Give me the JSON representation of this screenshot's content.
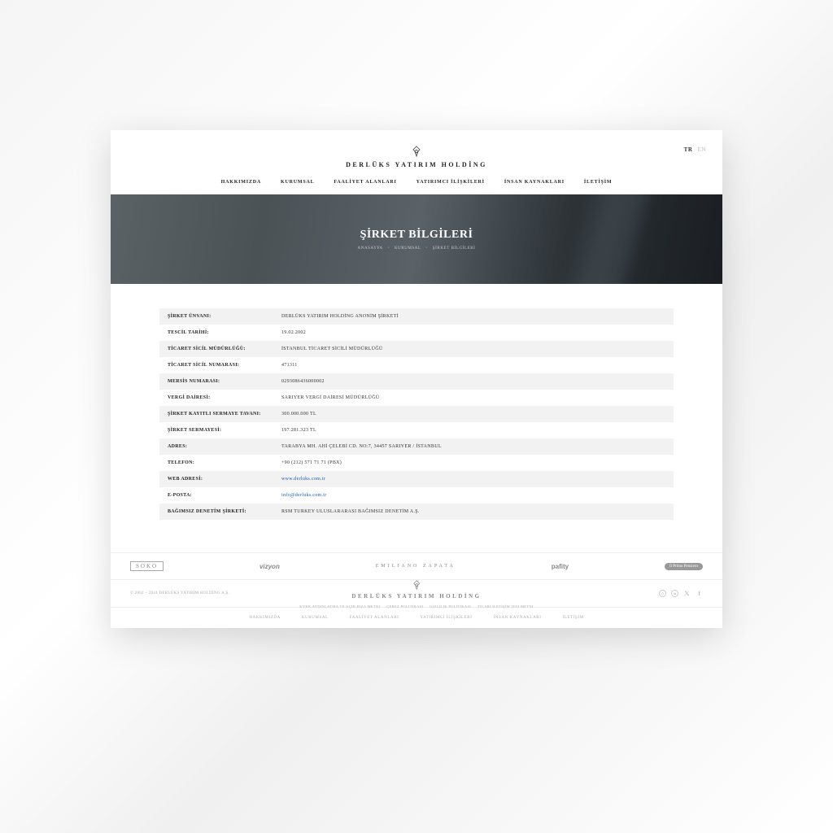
{
  "brand": "DERLÜKS YATIRIM HOLDİNG",
  "lang": {
    "tr": "TR",
    "en": "EN"
  },
  "nav": [
    "HAKKIMIZDA",
    "KURUMSAL",
    "FAALİYET ALANLARI",
    "YATIRIMCI İLİŞKİLERİ",
    "İNSAN KAYNAKLARI",
    "İLETİŞİM"
  ],
  "hero": {
    "title": "ŞİRKET BİLGİLERİ",
    "breadcrumb": [
      "ANASAYFA",
      "KURUMSAL",
      "ŞİRKET BİLGİLERİ"
    ]
  },
  "rows": [
    {
      "label": "ŞİRKET ÜNVANI:",
      "value": "DERLÜKS YATIRIM HOLDİNG ANONİM ŞİRKETİ"
    },
    {
      "label": "TESCİL TARİHİ:",
      "value": "19.02.2002"
    },
    {
      "label": "TİCARET SİCİL MÜDÜRLÜĞÜ:",
      "value": "İSTANBUL TİCARET SİCİLİ MÜDÜRLÜĞÜ"
    },
    {
      "label": "TİCARET SİCİL NUMARASI:",
      "value": "471311"
    },
    {
      "label": "MERSİS NUMARASI:",
      "value": "0293086436000002"
    },
    {
      "label": "VERGİ DAİRESİ:",
      "value": "SARIYER VERGİ DAİRESİ MÜDÜRLÜĞÜ"
    },
    {
      "label": "ŞİRKET KAYITLI SERMAYE TAVANI:",
      "value": "300.000.000 TL"
    },
    {
      "label": "ŞİRKET SERMAYESİ:",
      "value": "197.281.323 TL"
    },
    {
      "label": "ADRES:",
      "value": "TARABYA MH. AHİ ÇELEBİ CD. NO:7, 34457 SARIYER / İSTANBUL"
    },
    {
      "label": "TELEFON:",
      "value": "+90 (212) 571 71 71 (PBX)"
    },
    {
      "label": "WEB ADRESİ:",
      "value": "www.derluks.com.tr",
      "link": true
    },
    {
      "label": "E-POSTA:",
      "value": "info@derluks.com.tr",
      "link": true
    },
    {
      "label": "BAĞIMSIZ DENETİM ŞİRKETİ:",
      "value": "RSM TURKEY ULUSLARARASI BAĞIMSIZ DENETİM A.Ş."
    }
  ],
  "brands": {
    "soko": "SOKO",
    "vizyon": "vizyon",
    "ez": "EMILIANO ZAPATA",
    "pafity": "pafity",
    "pill": "Il Primo Pensiero"
  },
  "copyright": "© 2002 – 2024 DERLÜKS YATIRIM HOLDİNG A.Ş.",
  "legal": [
    "KVKK AYDINLATMA VE AÇIK RIZA METNİ",
    "ÇEREZ POLİTİKASI",
    "GİZLİLİK POLİTİKASI",
    "TİCARİ İLETİŞİM İZNİ METNİ"
  ]
}
